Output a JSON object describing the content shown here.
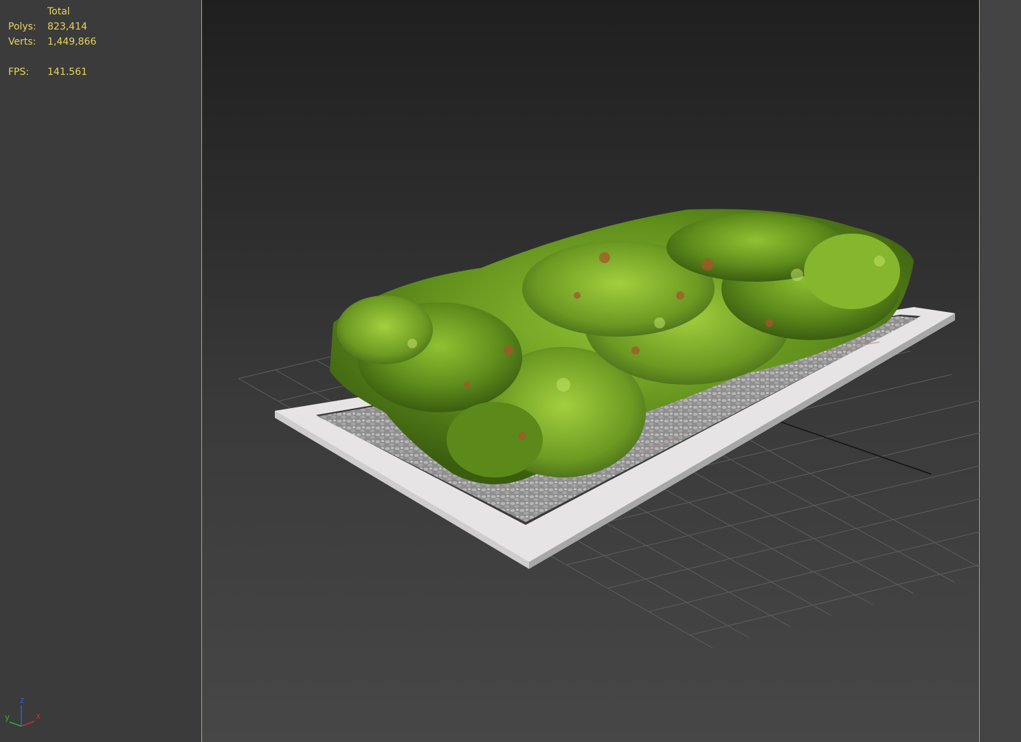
{
  "viewport_stats": {
    "header": "Total",
    "polys_label": "Polys:",
    "polys_value": "823,414",
    "verts_label": "Verts:",
    "verts_value": "1,449,866",
    "fps_label": "FPS:",
    "fps_value": "141.561"
  },
  "axis_gizmo": {
    "x": "x",
    "y": "y",
    "z": "z"
  },
  "colors": {
    "stats_text": "#e8d55a",
    "active_viewport_border": "#c8b418",
    "axis_x": "#d03030",
    "axis_y": "#30b030",
    "axis_z": "#3060e0"
  }
}
